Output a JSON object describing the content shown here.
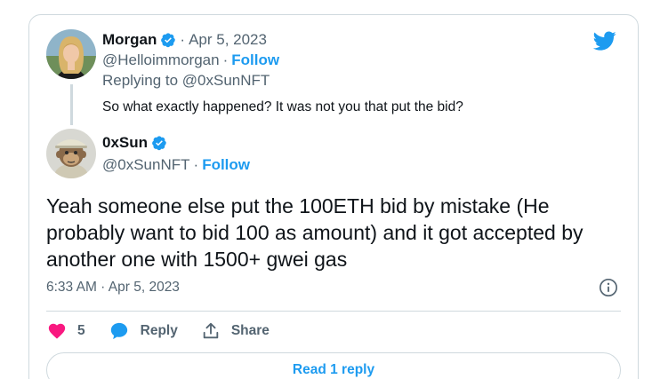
{
  "colors": {
    "brand": "#1d9bf0",
    "text": "#0f1419",
    "muted": "#536471",
    "like": "#f91880",
    "border": "#cfd9de"
  },
  "icons": [
    "twitter-bird-icon",
    "verified-badge-icon",
    "heart-icon",
    "reply-bubble-icon",
    "share-icon",
    "info-icon"
  ],
  "parent_tweet": {
    "name": "Morgan",
    "date": "Apr 5, 2023",
    "handle": "@Helloimmorgan",
    "follow": "Follow",
    "replying_to": "Replying to @0xSunNFT",
    "text": "So what exactly happened? It was not you that put the bid?"
  },
  "main_tweet": {
    "name": "0xSun",
    "handle": "@0xSunNFT",
    "follow": "Follow",
    "text": "Yeah someone else put the 100ETH bid by mistake (He probably want to bid 100 as amount) and it got accepted by another one with 1500+ gwei gas",
    "timestamp": "6:33 AM · Apr 5, 2023"
  },
  "actions": {
    "like_count": "5",
    "reply_label": "Reply",
    "share_label": "Share"
  },
  "read_replies_label": "Read 1 reply"
}
